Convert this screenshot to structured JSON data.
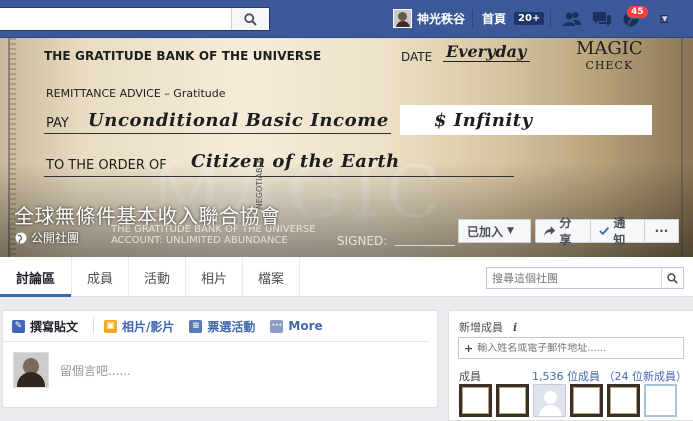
{
  "topbar": {
    "search_placeholder": "",
    "user_name": "神光秩谷",
    "home_label": "首頁",
    "home_count": "20+",
    "notifications_count": "45"
  },
  "cover": {
    "check": {
      "bank_name": "THE GRATITUDE BANK OF THE UNIVERSE",
      "date_label": "DATE",
      "date_value": "Everyday",
      "brand_line1": "MAGIC",
      "brand_line2": "CHECK",
      "remittance": "REMITTANCE ADVICE – Gratitude",
      "pay_label": "PAY",
      "pay_value": "Unconditional Basic Income",
      "amount": "$ Infinity",
      "order_label": "TO THE ORDER OF",
      "order_value": "Citizen of the Earth",
      "watermark": "MAGIC",
      "negotiable": "NEGOTIABLE",
      "bank_name_footer": "THE GRATITUDE BANK OF THE UNIVERSE",
      "account": "ACCOUNT: UNLIMITED ABUNDANCE",
      "signed_label": "SIGNED:"
    },
    "group_name": "全球無條件基本收入聯合協會",
    "privacy": "公開社團",
    "buttons": {
      "joined": "已加入",
      "share": "分享",
      "notify": "通知",
      "more": "···"
    }
  },
  "tabs": [
    {
      "label": "討論區",
      "active": true
    },
    {
      "label": "成員",
      "active": false
    },
    {
      "label": "活動",
      "active": false
    },
    {
      "label": "相片",
      "active": false
    },
    {
      "label": "檔案",
      "active": false
    }
  ],
  "group_search_placeholder": "搜尋這個社團",
  "composer": {
    "tabs": [
      {
        "label": "撰寫貼文",
        "icon": "pencil-icon",
        "color": "#4267b2"
      },
      {
        "label": "相片/影片",
        "icon": "photo-icon",
        "color": "#f5a623"
      },
      {
        "label": "票選活動",
        "icon": "poll-icon",
        "color": "#5b7bb5"
      },
      {
        "label": "More",
        "icon": "more-icon",
        "color": "#8b9dc3"
      }
    ],
    "placeholder": "留個言吧......"
  },
  "sidebar": {
    "add_title": "新增成員",
    "add_placeholder": "輸入姓名或電子郵件地址......",
    "members_label": "成員",
    "members_count": "1,536 位成員 （24 位新成員）"
  },
  "colors": {
    "topbar": "#3b5998",
    "link": "#4267b2",
    "notification_badge": "#fa3e3e"
  }
}
